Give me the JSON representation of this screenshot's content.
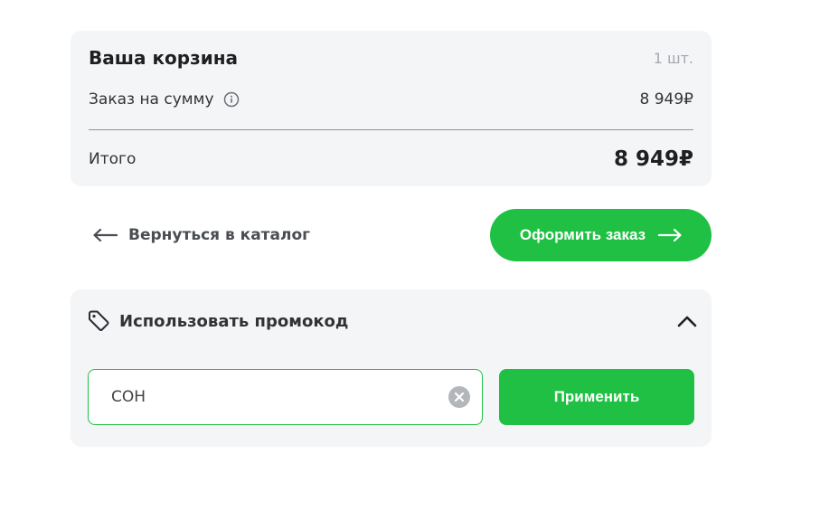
{
  "cart": {
    "title": "Ваша корзина",
    "count": "1 шт.",
    "sum_label": "Заказ на сумму",
    "sum_value": "8 949₽",
    "total_label": "Итого",
    "total_value": "8 949₽"
  },
  "actions": {
    "back_label": "Вернуться в каталог",
    "checkout_label": "Оформить заказ"
  },
  "promo": {
    "title": "Использовать промокод",
    "input_value": "СОН",
    "apply_label": "Применить"
  },
  "icons": {
    "info": "info-icon",
    "arrow_left": "arrow-left-icon",
    "arrow_right": "arrow-right-icon",
    "tag": "tag-icon",
    "chevron_up": "chevron-up-icon",
    "clear": "clear-icon"
  },
  "colors": {
    "accent": "#1fc044",
    "card_bg": "#f4f5f7",
    "text_dark": "#1f1f1f",
    "text_muted": "#a4a8ad"
  }
}
